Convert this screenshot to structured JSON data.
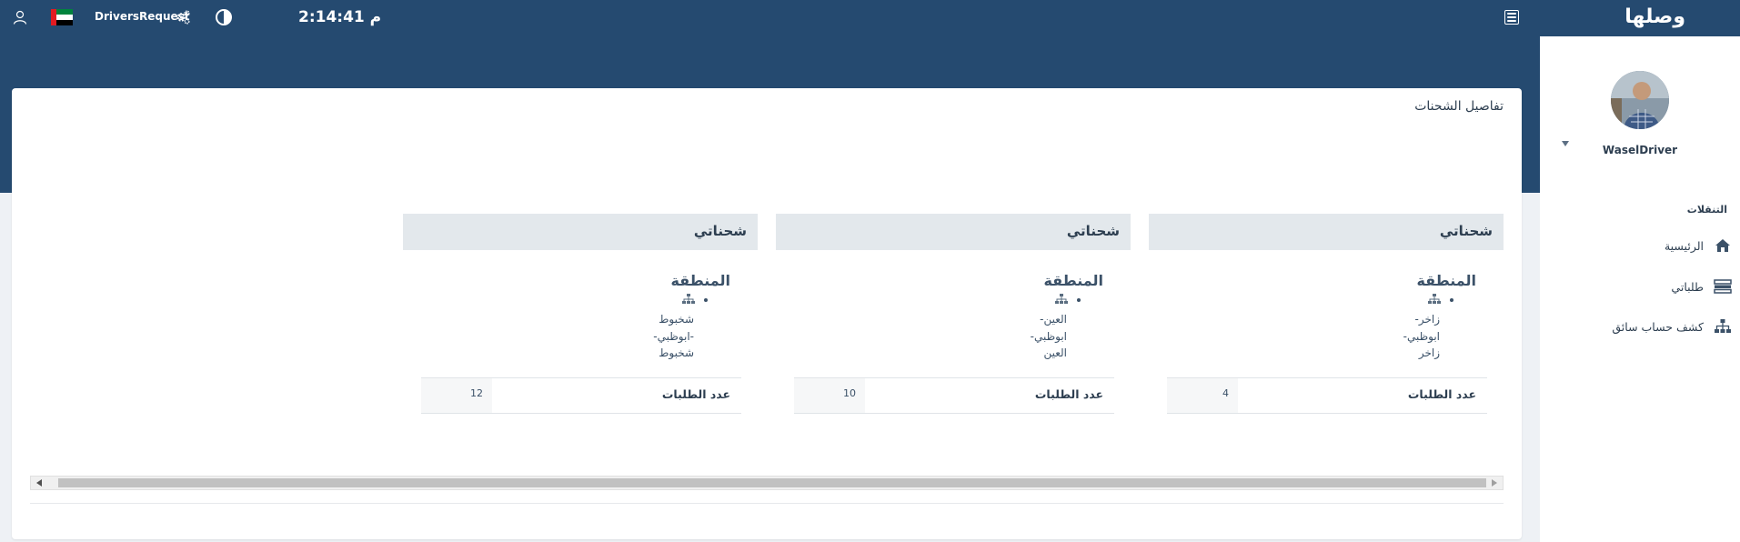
{
  "header": {
    "brand": "وصلها",
    "clock": "2:14:41 م",
    "app_name": "DriversRequest",
    "icons": [
      "menu-icon",
      "contrast-icon",
      "gear-icon",
      "uae-flag-icon",
      "user-icon"
    ]
  },
  "sidebar": {
    "username": "WaselDriver",
    "section_header": "التنقلات",
    "items": [
      {
        "label": "الرئيسية",
        "icon": "home-icon"
      },
      {
        "label": "طلباتي",
        "icon": "list-icon"
      },
      {
        "label": "كشف حساب سائق",
        "icon": "sitemap-icon"
      }
    ]
  },
  "main": {
    "title": "تفاصيل الشحنات",
    "shipments": [
      {
        "header": "شحناتي",
        "region_label": "المنطقة",
        "region_text": "زاخر-\nابوظبي-\nزاخر",
        "count_label": "عدد الطلبات",
        "count_value": "4"
      },
      {
        "header": "شحناتي",
        "region_label": "المنطقة",
        "region_text": "العين-\nابوظبي-\nالعين",
        "count_label": "عدد الطلبات",
        "count_value": "10"
      },
      {
        "header": "شحناتي",
        "region_label": "المنطقة",
        "region_text": "شخبوط\n-ابوظبي-\nشخبوط",
        "count_label": "عدد الطلبات",
        "count_value": "12"
      }
    ]
  },
  "colors": {
    "header_bg": "#254a70",
    "page_bg": "#eef1f5",
    "shipment_header_bg": "#e3e8ec",
    "text_primary": "#2d3e50"
  }
}
